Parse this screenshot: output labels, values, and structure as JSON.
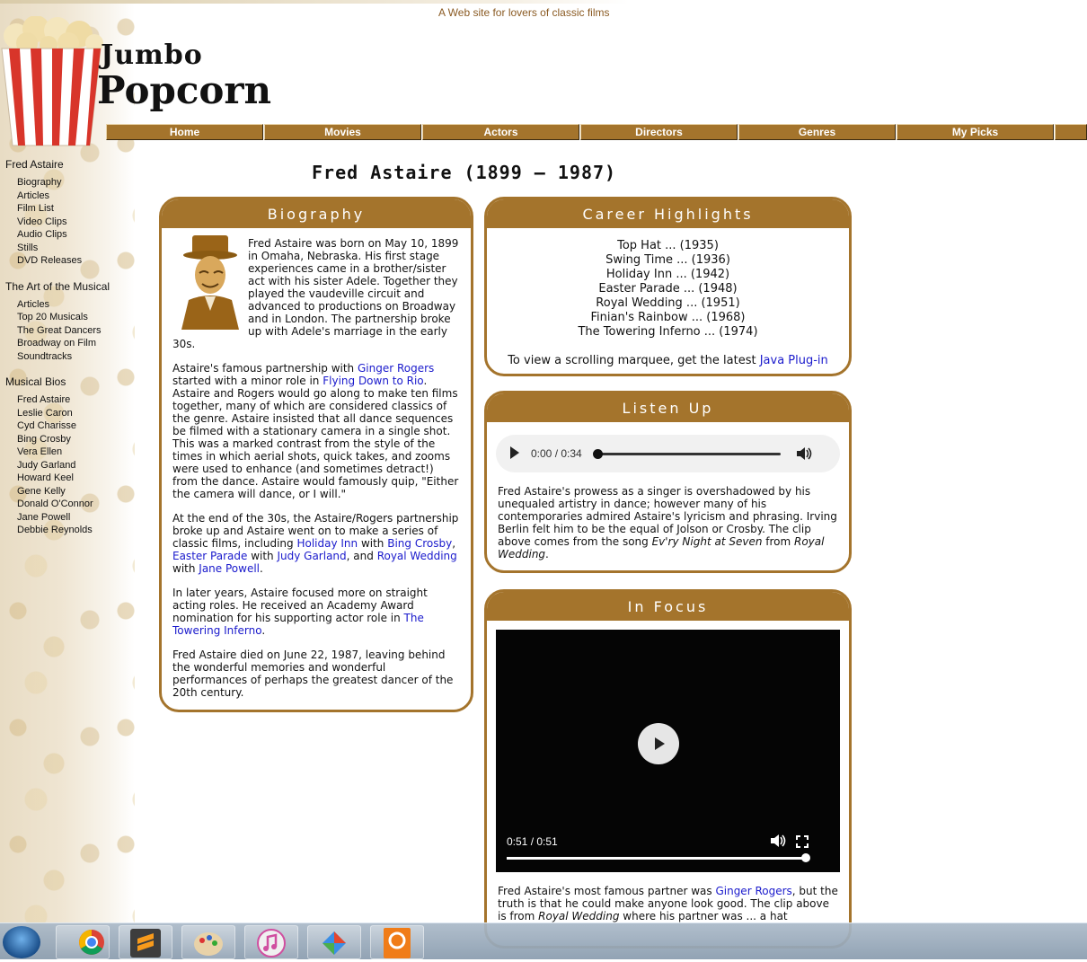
{
  "site": {
    "tagline": "A Web site for lovers of classic films",
    "logo_line1": "Jumbo",
    "logo_line2": "Popcorn"
  },
  "nav": [
    "Home",
    "Movies",
    "Actors",
    "Directors",
    "Genres",
    "My Picks"
  ],
  "sidebar": {
    "groups": [
      {
        "title": "Fred Astaire",
        "items": [
          "Biography",
          "Articles",
          "Film List",
          "Video Clips",
          "Audio Clips",
          "Stills",
          "DVD Releases"
        ]
      },
      {
        "title": "The Art of the Musical",
        "items": [
          "Articles",
          "Top 20 Musicals",
          "The Great Dancers",
          "Broadway on Film",
          "Soundtracks"
        ]
      },
      {
        "title": "Musical Bios",
        "items": [
          "Fred Astaire",
          "Leslie Caron",
          "Cyd Charisse",
          "Bing Crosby",
          "Vera Ellen",
          "Judy Garland",
          "Howard Keel",
          "Gene Kelly",
          "Donald O'Connor",
          "Jane Powell",
          "Debbie Reynolds"
        ]
      }
    ]
  },
  "page_title": "Fred Astaire (1899 — 1987)",
  "biography": {
    "heading": "Biography",
    "p1": "Fred Astaire was born on May 10, 1899 in Omaha, Nebraska. His first stage experiences came in a brother/sister act with his sister Adele. Together they played the vaudeville circuit and advanced to productions on Broadway and in London. The partnership broke up with Adele's marriage in the early 30s.",
    "p2_a": "Astaire's famous partnership with ",
    "p2_link1": "Ginger Rogers",
    "p2_b": " started with a minor role in ",
    "p2_link2": "Flying Down to Rio",
    "p2_c": ". Astaire and Rogers would go along to make ten films together, many of which are considered classics of the genre. Astaire insisted that all dance sequences be filmed with a stationary camera in a single shot. This was a marked contrast from the style of the times in which aerial shots, quick takes, and zooms were used to enhance (and sometimes detract!) from the dance. Astaire would famously quip, \"Either the camera will dance, or I will.\"",
    "p3_a": "At the end of the 30s, the Astaire/Rogers partnership broke up and Astaire went on to make a series of classic films, including ",
    "p3_link1": "Holiday Inn",
    "p3_b": " with ",
    "p3_link2": "Bing Crosby",
    "p3_c": ", ",
    "p3_link3": "Easter Parade",
    "p3_d": " with ",
    "p3_link4": "Judy Garland",
    "p3_e": ", and ",
    "p3_link5": "Royal Wedding",
    "p3_f": " with ",
    "p3_link6": "Jane Powell",
    "p3_g": ".",
    "p4_a": "In later years, Astaire focused more on straight acting roles. He received an Academy Award nomination for his supporting actor role in ",
    "p4_link1": "The Towering Inferno",
    "p4_b": ".",
    "p5": "Fred Astaire died on June 22, 1987, leaving behind the wonderful memories and wonderful performances of perhaps the greatest dancer of the 20th century."
  },
  "career": {
    "heading": "Career Highlights",
    "items": [
      "Top Hat ... (1935)",
      "Swing Time ... (1936)",
      "Holiday Inn ... (1942)",
      "Easter Parade ... (1948)",
      "Royal Wedding ... (1951)",
      "Finian's Rainbow ... (1968)",
      "The Towering Inferno ... (1974)"
    ],
    "note_a": "To view a scrolling marquee, get the latest ",
    "note_link": "Java Plug-in"
  },
  "listen": {
    "heading": "Listen Up",
    "audio_time": "0:00 / 0:34",
    "audio_progress": 0,
    "text_a": "Fred Astaire's prowess as a singer is overshadowed by his unequaled artistry in dance; however many of his contemporaries admired Astaire's lyricism and phrasing. Irving Berlin felt him to be the equal of Jolson or Crosby. The clip above comes from the song ",
    "text_em1": "Ev'ry Night at Seven",
    "text_b": " from ",
    "text_em2": "Royal Wedding",
    "text_c": "."
  },
  "focus": {
    "heading": "In Focus",
    "video_time": "0:51 / 0:51",
    "video_progress": 1,
    "text_a": "Fred Astaire's most famous partner was ",
    "text_link": "Ginger Rogers",
    "text_b": ", but the truth is that he could make anyone look good. The clip above is from ",
    "text_em": "Royal Wedding",
    "text_c": " where his partner was ... a hat"
  },
  "taskbar": {
    "apps": [
      "chrome-icon",
      "sublime-text-icon",
      "paint-icon",
      "itunes-icon",
      "app-icon",
      "pdf-icon"
    ]
  },
  "colors": {
    "accent": "#a4742c",
    "link": "#1a1acc"
  }
}
